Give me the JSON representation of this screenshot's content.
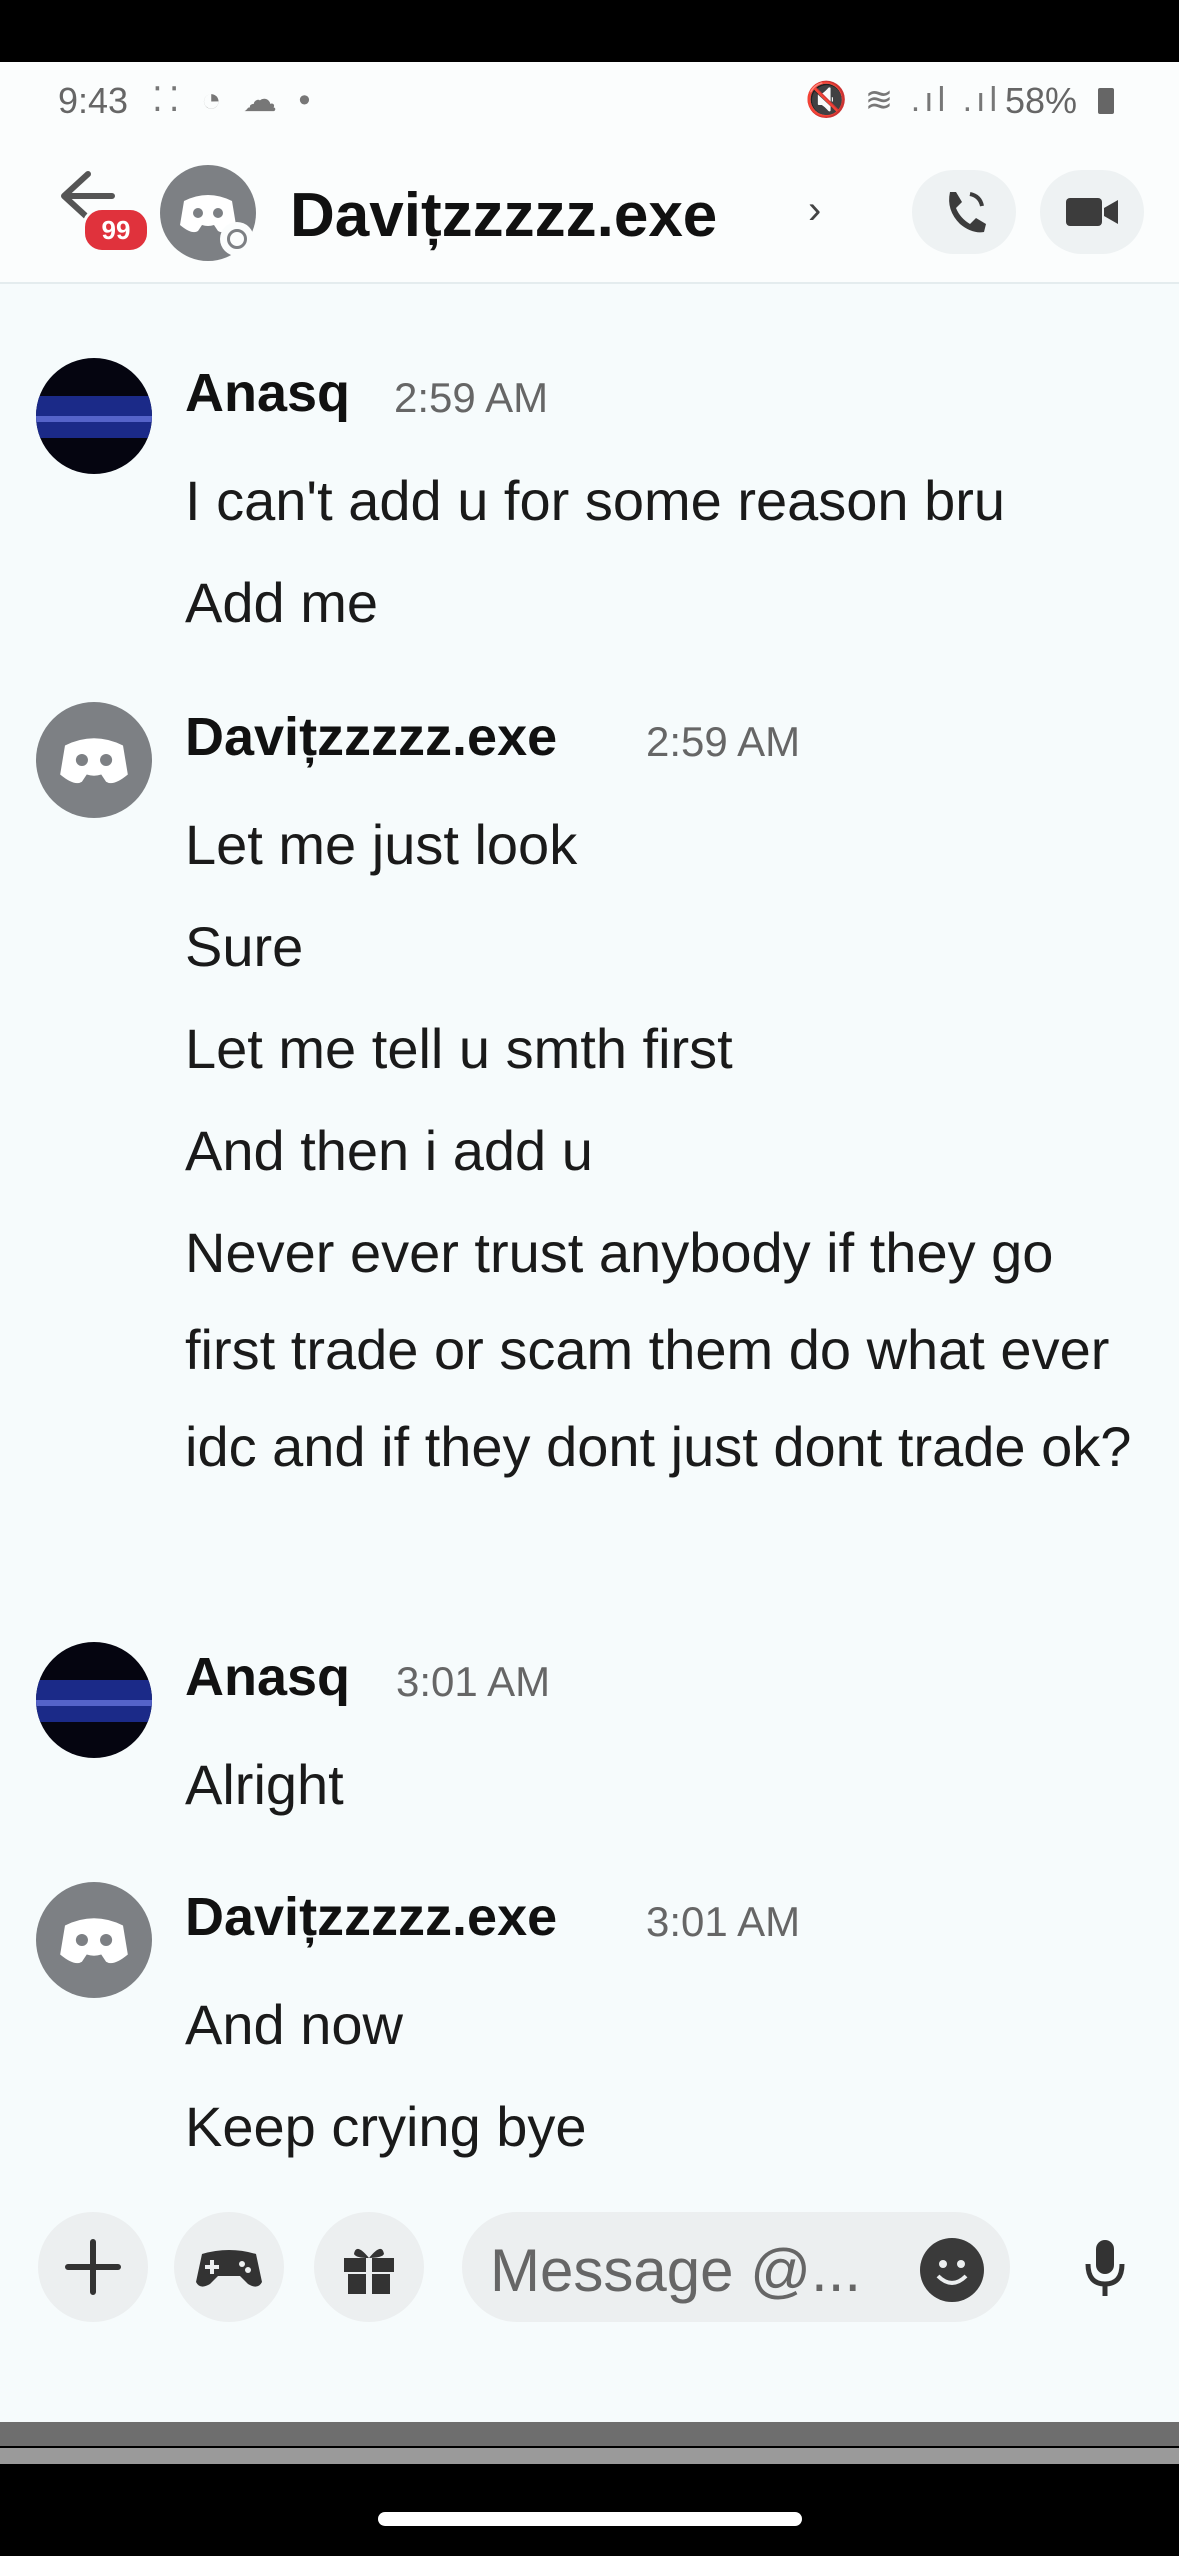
{
  "status_bar": {
    "time": "9:43",
    "left_icons": "⁚⁚ ◔ ☁ •",
    "right_icons": "🔇 ≋ .ıl .ıl",
    "battery": "58%"
  },
  "header": {
    "unread_badge": "99",
    "title": "Davițzzzzz.exe",
    "chevron": "›",
    "icons": [
      "back-arrow-icon",
      "call-icon",
      "video-icon"
    ]
  },
  "messages": [
    {
      "author": "Anasq",
      "time": "2:59 AM",
      "avatar": "dark-night",
      "lines": [
        "I can't add u for some reason bru",
        "Add me"
      ]
    },
    {
      "author": "Davițzzzzz.exe",
      "time": "2:59 AM",
      "avatar": "discord-default",
      "lines": [
        "Let me just look",
        "Sure",
        "Let me tell u smth first",
        "And then i add u",
        "Never ever trust anybody if they go first trade or scam them do what ever idc and if they dont just dont trade ok?"
      ]
    },
    {
      "author": "Anasq",
      "time": "3:01 AM",
      "avatar": "dark-night",
      "lines": [
        "Alright"
      ]
    },
    {
      "author": "Davițzzzzz.exe",
      "time": "3:01 AM",
      "avatar": "discord-default",
      "lines": [
        "And now",
        "Keep crying bye"
      ]
    }
  ],
  "composer": {
    "placeholder": "Message @...",
    "buttons": [
      "plus-icon",
      "gamepad-icon",
      "gift-icon",
      "emoji-icon",
      "mic-icon"
    ]
  },
  "colors": {
    "background": "#f6fbfc",
    "badge": "#e0323c",
    "default_avatar": "#7d8084"
  }
}
